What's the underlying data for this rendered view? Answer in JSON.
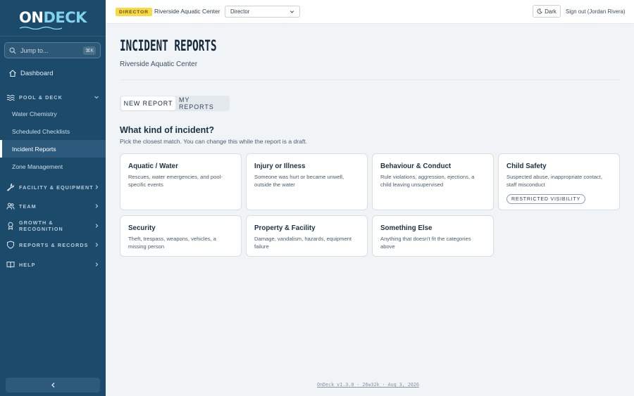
{
  "brand": {
    "logo_on": "ON",
    "logo_deck": "DECK"
  },
  "sidebar": {
    "jump_placeholder": "Jump to...",
    "jump_shortcut": "⌘K",
    "dashboard_label": "Dashboard",
    "groups": {
      "pool_deck": "POOL & DECK",
      "facility_equipment": "FACILITY & EQUIPMENT",
      "team": "TEAM",
      "growth_recognition": "GROWTH & RECOGNITION",
      "reports_records": "REPORTS & RECORDS",
      "help": "HELP"
    },
    "pool_deck_items": [
      "Water Chemistry",
      "Scheduled Checklists",
      "Incident Reports",
      "Zone Management"
    ],
    "active_item": "Incident Reports"
  },
  "topbar": {
    "role_badge": "DIRECTOR",
    "facility_name": "Riverside Aquatic Center",
    "role_select_value": "Director",
    "dark_toggle_label": "Dark",
    "signout_label": "Sign out (Jordan Rivera)"
  },
  "main": {
    "title": "INCIDENT REPORTS",
    "subtitle": "Riverside Aquatic Center",
    "tabs": [
      "NEW REPORT",
      "MY REPORTS"
    ],
    "active_tab": "NEW REPORT",
    "section_title": "What kind of incident?",
    "section_subtitle": "Pick the closest match. You can change this while the report is a draft.",
    "categories": [
      {
        "title": "Aquatic / Water",
        "description": "Rescues, water emergencies, and pool-specific events"
      },
      {
        "title": "Injury or Illness",
        "description": "Someone was hurt or became unwell, outside the water"
      },
      {
        "title": "Behaviour & Conduct",
        "description": "Rule violations, aggression, ejections, a child leaving unsupervised"
      },
      {
        "title": "Child Safety",
        "description": "Suspected abuse, inappropriate contact, staff misconduct",
        "badge": "RESTRICTED VISIBILITY"
      },
      {
        "title": "Security",
        "description": "Theft, trespass, weapons, vehicles, a missing person"
      },
      {
        "title": "Property & Facility",
        "description": "Damage, vandalism, hazards, equipment failure"
      },
      {
        "title": "Something Else",
        "description": "Anything that doesn't fit the categories above"
      }
    ]
  },
  "footer": {
    "version": "OnDeck v1.3.0 · 26w32k · Aug 3, 2026"
  },
  "colors": {
    "sidebar_bg": "#1c4a6b",
    "accent_cyan": "#7fd3ea",
    "badge_yellow": "#f7d94a",
    "page_bg": "#f1f4f7"
  },
  "icons": [
    "search-icon",
    "home-icon",
    "waves-icon",
    "chevron-down-icon",
    "wrench-icon",
    "chevron-right-icon",
    "users-icon",
    "award-icon",
    "shield-icon",
    "book-icon",
    "chevron-left-icon",
    "moon-icon"
  ]
}
